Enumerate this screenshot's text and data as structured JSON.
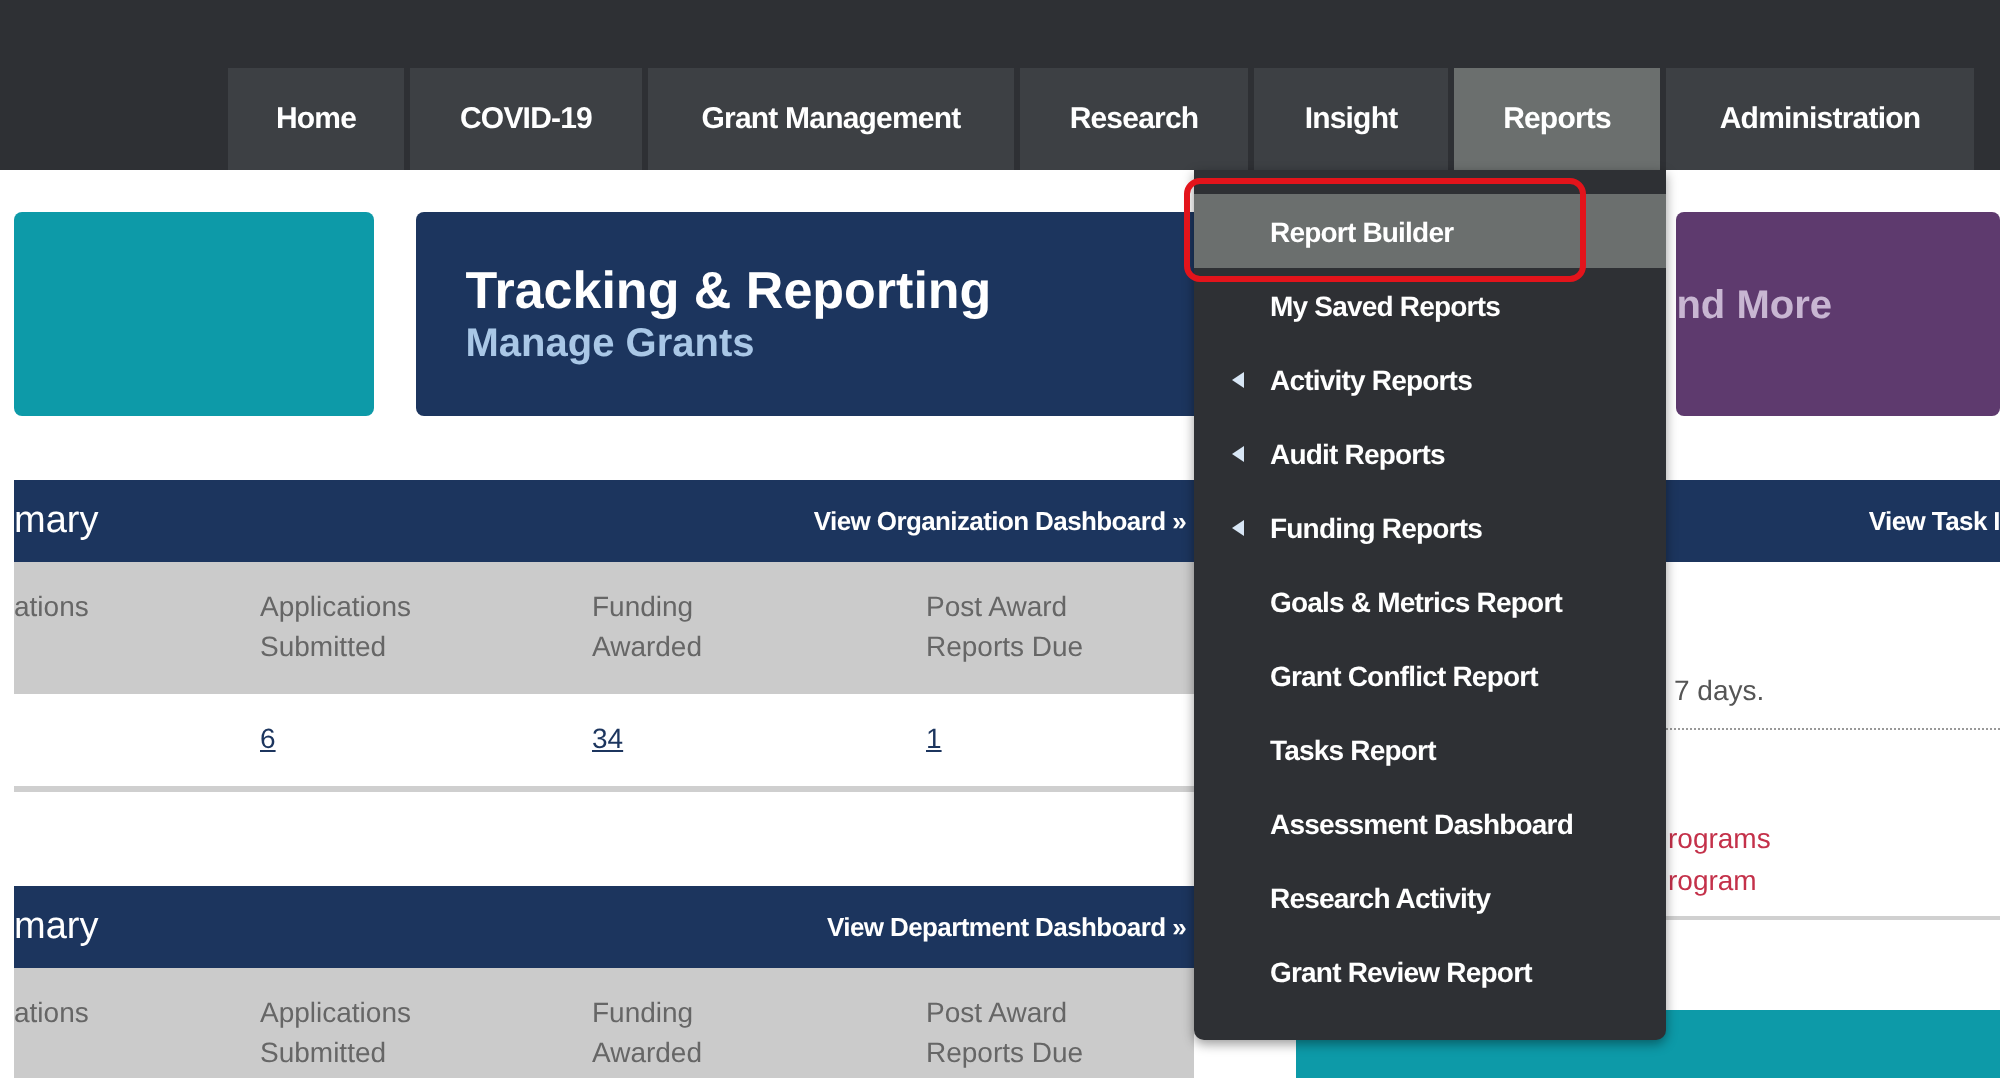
{
  "nav": [
    {
      "label": "Home",
      "selected": false
    },
    {
      "label": "COVID-19",
      "selected": false
    },
    {
      "label": "Grant Management",
      "selected": false
    },
    {
      "label": "Research",
      "selected": false
    },
    {
      "label": "Insight",
      "selected": false
    },
    {
      "label": "Reports",
      "selected": true
    },
    {
      "label": "Administration",
      "selected": false
    }
  ],
  "tiles": [
    {
      "kind": "blank",
      "color": "#0d9aa8"
    },
    {
      "kind": "text",
      "color": "#1c355e",
      "title": "Tracking & Reporting",
      "subtitle": "Manage Grants"
    },
    {
      "kind": "partial",
      "color": "#5e3a6e",
      "subtitle": "nd More"
    }
  ],
  "panels": [
    {
      "title": "mary",
      "link": "View Organization Dashboard »",
      "columns": [
        "ations",
        "Applications\nSubmitted",
        "Funding\nAwarded",
        "Post Award\nReports Due"
      ],
      "values": [
        "6",
        "34",
        "1"
      ]
    },
    {
      "title": "mary",
      "link": "View Department Dashboard »",
      "columns": [
        "ations",
        "Applications\nSubmitted",
        "Funding\nAwarded",
        "Post Award\nReports Due"
      ]
    }
  ],
  "side_panel": {
    "link": "View Task I",
    "notice": "7 days.",
    "links": [
      "rograms",
      "rogram"
    ]
  },
  "reports_menu": [
    {
      "label": "Report Builder",
      "selected": true,
      "submenu": false
    },
    {
      "label": "My Saved Reports",
      "selected": false,
      "submenu": false
    },
    {
      "label": "Activity Reports",
      "selected": false,
      "submenu": true
    },
    {
      "label": "Audit Reports",
      "selected": false,
      "submenu": true
    },
    {
      "label": "Funding Reports",
      "selected": false,
      "submenu": true
    },
    {
      "label": "Goals & Metrics Report",
      "selected": false,
      "submenu": false
    },
    {
      "label": "Grant Conflict Report",
      "selected": false,
      "submenu": false
    },
    {
      "label": "Tasks Report",
      "selected": false,
      "submenu": false
    },
    {
      "label": "Assessment Dashboard",
      "selected": false,
      "submenu": false
    },
    {
      "label": "Research Activity",
      "selected": false,
      "submenu": false
    },
    {
      "label": "Grant Review Report",
      "selected": false,
      "submenu": false
    }
  ]
}
